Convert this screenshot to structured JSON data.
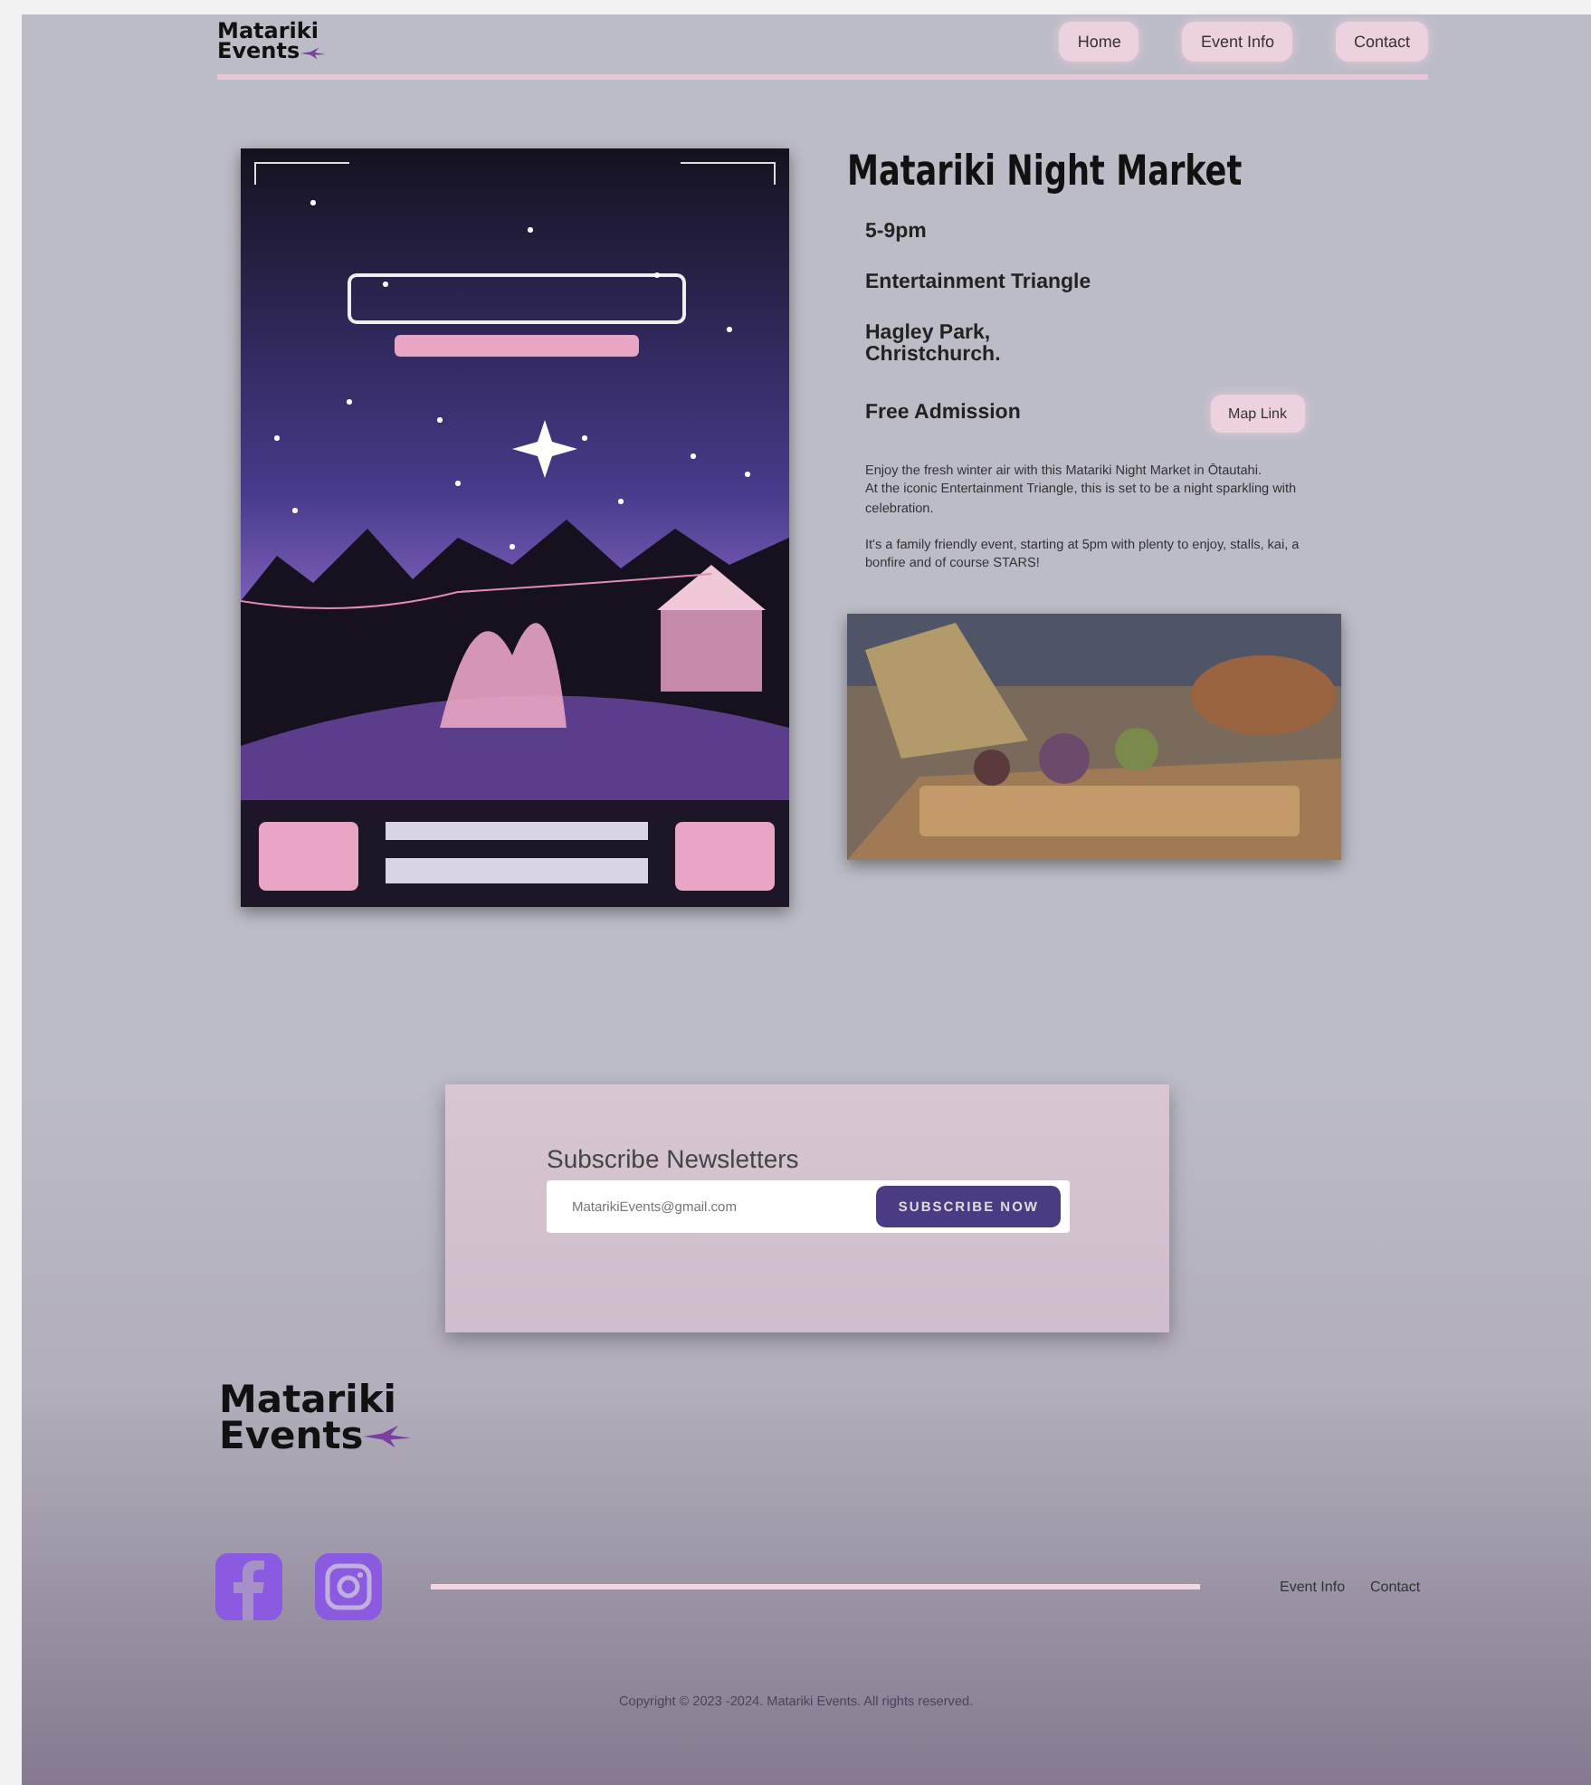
{
  "header": {
    "logo": {
      "line_1": "Matariki",
      "line_2": "Events"
    },
    "nav": [
      "Home",
      "Event Info",
      "Contact"
    ]
  },
  "event": {
    "title": "Matariki Night Market",
    "details": [
      "5-9pm",
      "Entertainment Triangle",
      "Hagley Park,\nChristchurch.",
      "Free Admission"
    ],
    "map_link": "Map Link",
    "paragraphs": [
      "Enjoy the fresh winter air with this Matariki Night Market in Ōtautahi.\nAt the iconic Entertainment Triangle, this is set to be a night sparkling with celebration.",
      "It's a family friendly event, starting at 5pm with plenty to enjoy, stalls, kai, a bonfire and of course STARS!"
    ]
  },
  "newsletter": {
    "title": "Subscribe Newsletters",
    "placeholder": "MatarikiEvents@gmail.com",
    "button": "SUBSCRIBE NOW"
  },
  "footer": {
    "logo": {
      "line_1": "Matariki",
      "line_2": "Events"
    },
    "links": [
      "Event Info",
      "Contact"
    ],
    "copyright": "Copyright © 2023 -2024. Matariki Events. All rights reserved."
  }
}
